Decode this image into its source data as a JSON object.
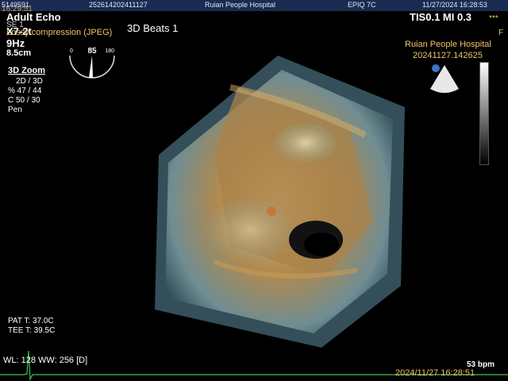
{
  "top_bar": {
    "patient_id": "5149591",
    "exam_id": "252614202411127",
    "hospital": "Ruian People Hospital",
    "system": "EPIQ 7C",
    "datetime": "11/27/2024 16:28:53"
  },
  "left_panel": {
    "overlay_time": "16:29:51",
    "preset": "Adult Echo",
    "sequence": "SE 1",
    "probe": "X7-2t",
    "compression": "Lossy compression (JPEG)",
    "frame_rate": "9Hz",
    "depth": "8.5cm",
    "mode_title": "3D Zoom",
    "mode_lines": [
      "2D / 3D",
      "% 47 / 44",
      "C  50 / 30",
      "Pen"
    ],
    "pat_temp": "PAT T: 37.0C",
    "tee_temp": "TEE T: 39.5C",
    "wl_ww": "WL: 128 WW: 256 [D]"
  },
  "dial": {
    "min": "0",
    "value": "85",
    "max": "180"
  },
  "beats": "3D Beats 1",
  "right_panel": {
    "tis_mi": "TIS0.1   MI 0.3",
    "indicators": "***",
    "marker": "F",
    "hospital": "Ruian People Hospital",
    "study_id": "20241127.142625",
    "heart_rate": "53 bpm",
    "footer_datetime": "2024/11/27 16:28:51"
  },
  "colors": {
    "accent_bar": "#1a2b52",
    "amber_text": "#f0c36a",
    "ecg": "#3cc24a"
  }
}
